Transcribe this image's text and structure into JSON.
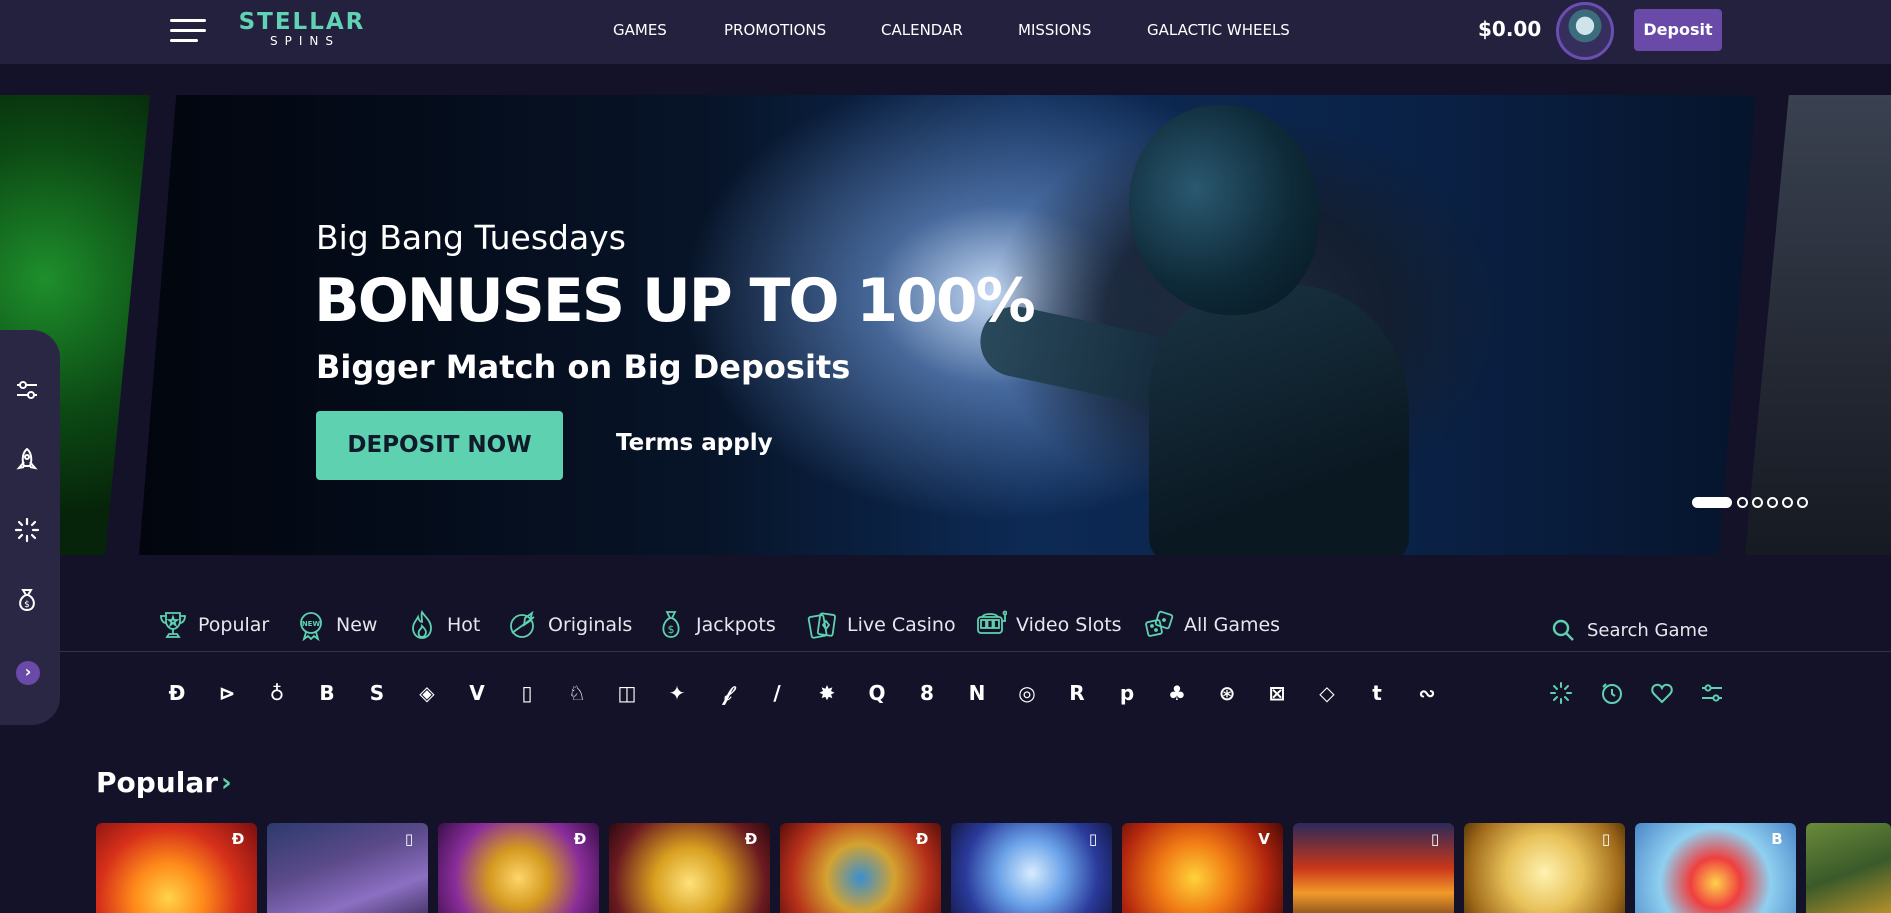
{
  "header": {
    "logo_main": "STELLAR",
    "logo_sub": "SPINS",
    "nav": [
      "GAMES",
      "PROMOTIONS",
      "CALENDAR",
      "MISSIONS",
      "GALACTIC WHEELS"
    ],
    "balance": "$0.00",
    "deposit_label": "Deposit"
  },
  "hero": {
    "subtitle": "Big Bang Tuesdays",
    "title": "BONUSES UP TO 100%",
    "tagline": "Bigger Match on Big Deposits",
    "cta_label": "DEPOSIT NOW",
    "terms_label": "Terms apply",
    "slide_count": 6,
    "active_slide": 1
  },
  "side_toolbar": {
    "icons": [
      "filters-icon",
      "rocket-icon",
      "loading-spinner-icon",
      "money-bag-icon"
    ],
    "toggle_label": "›"
  },
  "categories": {
    "tabs": [
      {
        "label": "Popular",
        "icon": "trophy-icon"
      },
      {
        "label": "New",
        "icon": "new-badge-icon"
      },
      {
        "label": "Hot",
        "icon": "flame-icon"
      },
      {
        "label": "Originals",
        "icon": "rocket-planet-icon"
      },
      {
        "label": "Jackpots",
        "icon": "money-bag-icon"
      },
      {
        "label": "Live Casino",
        "icon": "playing-cards-icon"
      },
      {
        "label": "Video Slots",
        "icon": "slot-machine-icon"
      },
      {
        "label": "All Games",
        "icon": "dice-icon"
      }
    ],
    "search_placeholder": "Search Game"
  },
  "providers": {
    "marks": [
      "Ð",
      "⊳",
      "♁",
      "B",
      "S",
      "◈",
      "V",
      "▯",
      "♘",
      "◫",
      "✦",
      "𝒻",
      "/",
      "✸",
      "Q",
      "8",
      "N",
      "◎",
      "R",
      "p",
      "♣",
      "⊛",
      "⊠",
      "◇",
      "t",
      "∾"
    ],
    "filter_icons": [
      "spinner-icon",
      "clock-icon",
      "heart-icon",
      "sliders-icon"
    ]
  },
  "popular": {
    "title": "Popular",
    "arrow": "›",
    "games": [
      {
        "provider_mark": "Ð",
        "art": "sun-icon"
      },
      {
        "provider_mark": "▯",
        "art": "wolf-icon"
      },
      {
        "provider_mark": "Ð",
        "art": "golden-dragon-icon"
      },
      {
        "provider_mark": "Ð",
        "art": "golden-ox-icon"
      },
      {
        "provider_mark": "Ð",
        "art": "pharaoh-icon"
      },
      {
        "provider_mark": "▯",
        "art": "ice-queen-icon"
      },
      {
        "provider_mark": "V",
        "art": "fire-dragon-icon"
      },
      {
        "provider_mark": "▯",
        "art": "cowboy-icon"
      },
      {
        "provider_mark": "▯",
        "art": "wealth-god-icon"
      },
      {
        "provider_mark": "B",
        "art": "gem-sphere-icon"
      }
    ]
  },
  "colors": {
    "accent": "#5ed1b0",
    "brand_purple": "#6a4aa8",
    "header_bg": "#24213f",
    "page_bg": "#141228"
  }
}
